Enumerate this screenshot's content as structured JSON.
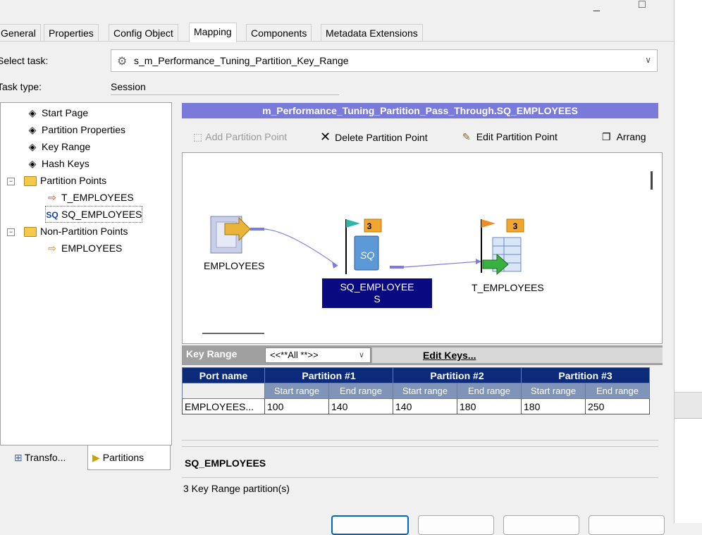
{
  "window": {
    "minimize_glyph": "_",
    "maximize_glyph": "□"
  },
  "tabs": [
    "General",
    "Properties",
    "Config Object",
    "Mapping",
    "Components",
    "Metadata Extensions"
  ],
  "active_tab": "Mapping",
  "select_task": {
    "label": "Select task:",
    "value": "s_m_Performance_Tuning_Partition_Key_Range",
    "icon": "gear-icon"
  },
  "task_type": {
    "label": "Task type:",
    "value": "Session"
  },
  "tree": {
    "start_page": "Start Page",
    "partition_properties": "Partition Properties",
    "key_range": "Key Range",
    "hash_keys": "Hash Keys",
    "partition_points": "Partition Points",
    "t_employees": "T_EMPLOYEES",
    "sq_employees": "SQ_EMPLOYEES",
    "non_partition_points": "Non-Partition Points",
    "employees": "EMPLOYEES",
    "sq_glyph": "SQ"
  },
  "bottom_tabs": {
    "transformations": "Transfo...",
    "partitions": "Partitions"
  },
  "mapping_title": "m_Performance_Tuning_Partition_Pass_Through.SQ_EMPLOYEES",
  "toolbar": {
    "add": "Add Partition Point",
    "delete": "Delete Partition Point",
    "edit": "Edit Partition Point",
    "arrange": "Arrang"
  },
  "diagram": {
    "source": "EMPLOYEES",
    "sq_line1": "SQ_EMPLOYEE",
    "sq_line2": "S",
    "target": "T_EMPLOYEES",
    "sq_partitions": "3",
    "target_partitions": "3"
  },
  "key_range": {
    "title": "Key Range",
    "filter": "<<**All **>>",
    "edit_keys": "Edit Keys...",
    "port_header": "Port name",
    "partitions": [
      "Partition #1",
      "Partition #2",
      "Partition #3"
    ],
    "start": "Start range",
    "end": "End range",
    "row": {
      "port": "EMPLOYEES...",
      "values": [
        "100",
        "140",
        "140",
        "180",
        "180",
        "250"
      ]
    }
  },
  "info": {
    "name": "SQ_EMPLOYEES",
    "count": "3 Key Range partition(s)"
  }
}
